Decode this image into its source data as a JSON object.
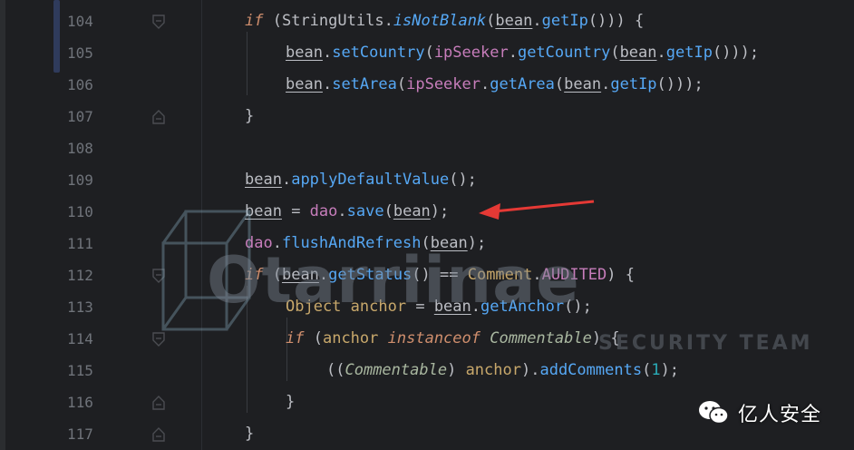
{
  "editor": {
    "lines": [
      {
        "number": "104"
      },
      {
        "number": "105"
      },
      {
        "number": "106"
      },
      {
        "number": "107"
      },
      {
        "number": "108"
      },
      {
        "number": "109"
      },
      {
        "number": "110"
      },
      {
        "number": "111"
      },
      {
        "number": "112"
      },
      {
        "number": "113"
      },
      {
        "number": "114"
      },
      {
        "number": "115"
      },
      {
        "number": "116"
      },
      {
        "number": "117"
      }
    ]
  },
  "tokens": {
    "if": "if",
    "stringutils": "StringUtils",
    "isnotblank": "isNotBlank",
    "bean": "bean",
    "getip": "getIp",
    "setcountry": "setCountry",
    "ipseeker": "ipSeeker",
    "getcountry": "getCountry",
    "setarea": "setArea",
    "getarea": "getArea",
    "applydefault": "applyDefaultValue",
    "dao": "dao",
    "save": "save",
    "flush": "flushAndRefresh",
    "getstatus": "getStatus",
    "comment": "Comment",
    "audited": "AUDITED",
    "object": "Object",
    "anchor": "anchor",
    "getanchor": "getAnchor",
    "instanceof": "instanceof",
    "commentable": "Commentable",
    "addcomments": "addComments",
    "one": "1"
  },
  "watermark": {
    "title": "Otarriinae",
    "subtitle": "SECURITY TEAM"
  },
  "brand": {
    "name": "亿人安全"
  },
  "colors": {
    "background": "#1e1f22",
    "keyword": "#cf8e6d",
    "method": "#56a8f5",
    "field": "#c77dbb",
    "arrow": "#e53935"
  }
}
